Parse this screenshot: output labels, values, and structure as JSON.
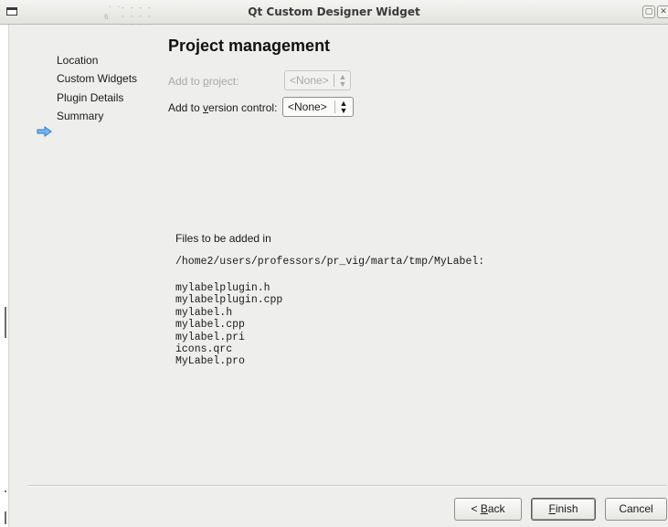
{
  "window": {
    "title": "Qt Custom Designer Widget"
  },
  "steps": [
    {
      "label": "Location",
      "active": false
    },
    {
      "label": "Custom Widgets",
      "active": false
    },
    {
      "label": "Plugin Details",
      "active": false
    },
    {
      "label": "Summary",
      "active": true
    }
  ],
  "page": {
    "title": "Project management"
  },
  "form": {
    "add_to_project_label_pre": "Add to ",
    "add_to_project_label_mnem": "p",
    "add_to_project_label_post": "roject:",
    "add_to_project_value": "<None>",
    "add_to_vc_label_pre": "Add to ",
    "add_to_vc_label_mnem": "v",
    "add_to_vc_label_post": "ersion control:",
    "add_to_vc_value": "<None>"
  },
  "files": {
    "caption": "Files to be added in",
    "path": "/home2/users/professors/pr_vig/marta/tmp/MyLabel:",
    "list": [
      "mylabelplugin.h",
      "mylabelplugin.cpp",
      "mylabel.h",
      "mylabel.cpp",
      "mylabel.pri",
      "icons.qrc",
      "MyLabel.pro"
    ]
  },
  "buttons": {
    "back_pre": "< ",
    "back_mnem": "B",
    "back_post": "ack",
    "finish_mnem": "F",
    "finish_post": "inish",
    "cancel": "Cancel"
  },
  "colors": {
    "dialog_bg": "#eeeeec",
    "active_step_arrow": "#3b8ee6",
    "disabled_text": "#a9a9a7"
  },
  "icons": {
    "window": "window-icon",
    "step_current": "arrow-right-icon",
    "maximize": "maximize-icon",
    "close": "close-icon",
    "combo_arrows": "updown-arrows-icon"
  }
}
